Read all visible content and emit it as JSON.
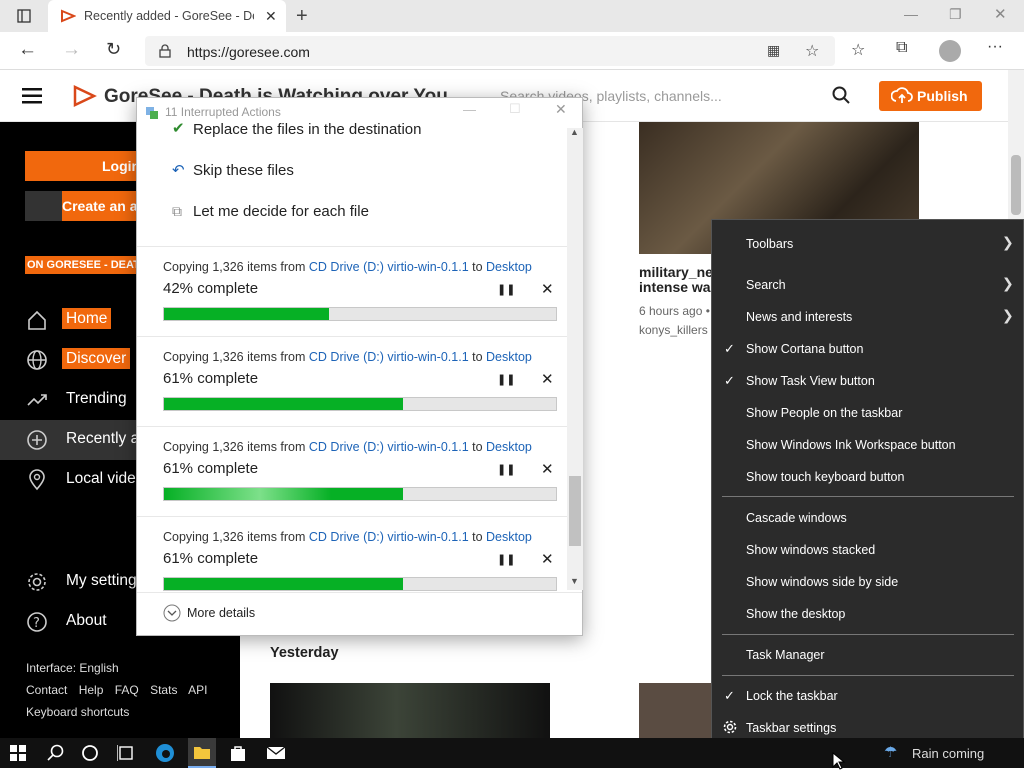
{
  "browser": {
    "tab_title": "Recently added - GoreSee - Deat",
    "url": "https://goresee.com"
  },
  "site": {
    "brand": "GoreSee - Death is Watching over You",
    "search_placeholder": "Search videos, playlists, channels...",
    "publish_label": "Publish"
  },
  "sidebar": {
    "login": "Login",
    "create": "Create an ac",
    "banner": "ON GORESEE - DEAT",
    "items": [
      {
        "label": "Home",
        "highlight": true
      },
      {
        "label": "Discover",
        "highlight": true
      },
      {
        "label": "Trending",
        "highlight": false
      },
      {
        "label": "Recently a",
        "highlight": false
      },
      {
        "label": "Local vide",
        "highlight": false
      },
      {
        "label": "My setting",
        "highlight": false
      },
      {
        "label": "About",
        "highlight": false
      }
    ],
    "interface": "Interface: English",
    "links": [
      "Contact",
      "Help",
      "FAQ",
      "Stats",
      "API"
    ],
    "shortcuts": "Keyboard shortcuts"
  },
  "main": {
    "video_title_1": "military_ne",
    "video_title_2": "intense wa",
    "video_meta": "6 hours ago •",
    "video_channel": "konys_killers",
    "section": "Yesterday"
  },
  "dialog": {
    "title": "11 Interrupted Actions",
    "options": [
      "Replace the files in the destination",
      "Skip these files",
      "Let me decide for each file"
    ],
    "copy_prefix": "Copying 1,326 items from ",
    "source": "CD Drive (D:) virtio-win-0.1.1",
    "to": " to ",
    "dest": "Desktop",
    "jobs": [
      {
        "percent_text": "42% complete",
        "progress": 0.42
      },
      {
        "percent_text": "61% complete",
        "progress": 0.61
      },
      {
        "percent_text": "61% complete",
        "progress": 0.61
      },
      {
        "percent_text": "61% complete",
        "progress": 0.61
      }
    ],
    "more_details": "More details"
  },
  "context_menu": {
    "items": [
      {
        "label": "Toolbars",
        "submenu": true,
        "checked": false
      },
      {
        "label": "Search",
        "submenu": true,
        "checked": false
      },
      {
        "label": "News and interests",
        "submenu": true,
        "checked": false
      },
      {
        "label": "Show Cortana button",
        "submenu": false,
        "checked": true
      },
      {
        "label": "Show Task View button",
        "submenu": false,
        "checked": true
      },
      {
        "label": "Show People on the taskbar",
        "submenu": false,
        "checked": false
      },
      {
        "label": "Show Windows Ink Workspace button",
        "submenu": false,
        "checked": false
      },
      {
        "label": "Show touch keyboard button",
        "submenu": false,
        "checked": false
      },
      {
        "label": "Cascade windows",
        "submenu": false,
        "checked": false
      },
      {
        "label": "Show windows stacked",
        "submenu": false,
        "checked": false
      },
      {
        "label": "Show windows side by side",
        "submenu": false,
        "checked": false
      },
      {
        "label": "Show the desktop",
        "submenu": false,
        "checked": false
      },
      {
        "label": "Task Manager",
        "submenu": false,
        "checked": false
      },
      {
        "label": "Lock the taskbar",
        "submenu": false,
        "checked": true
      },
      {
        "label": "Taskbar settings",
        "submenu": false,
        "checked": false
      }
    ]
  },
  "taskbar": {
    "weather": "Rain coming"
  },
  "colors": {
    "accent": "#f1680d",
    "progress": "#06b025",
    "link": "#1c63b7",
    "menu_bg": "#2b2b2b"
  },
  "icons": [
    "window-icon",
    "tab-favicon",
    "close-icon",
    "new-tab-icon",
    "back-icon",
    "forward-icon",
    "refresh-icon",
    "lock-icon",
    "apps-icon",
    "favorite-add-icon",
    "favorites-icon",
    "collections-icon",
    "profile-icon",
    "more-icon",
    "hamburger-icon",
    "logo-icon",
    "search-icon",
    "upload-icon",
    "home-icon",
    "globe-icon",
    "trending-icon",
    "plus-circle-icon",
    "location-icon",
    "gear-icon",
    "help-icon",
    "copy-icon",
    "check-icon",
    "skip-icon",
    "decide-icon",
    "pause-icon",
    "chevron-down-icon",
    "windows-icon",
    "cortana-icon",
    "task-view-icon",
    "edge-icon",
    "folder-icon",
    "store-icon",
    "mail-icon",
    "cursor-icon"
  ]
}
